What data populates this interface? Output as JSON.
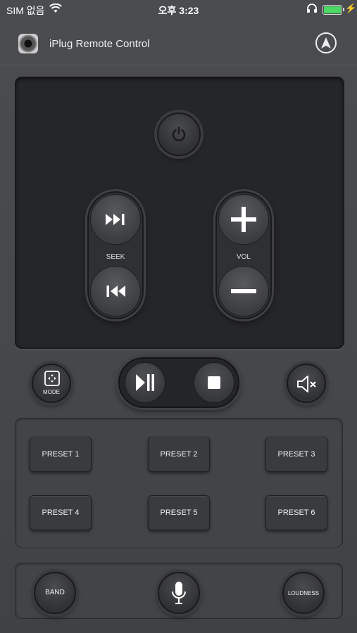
{
  "status_bar": {
    "carrier": "SIM 없음",
    "time": "오후 3:23",
    "battery_color": "#4cd964"
  },
  "header": {
    "title": "iPlug Remote Control",
    "app_icon": "speaker-app-icon",
    "nav_icon": "navigation-arrow-icon"
  },
  "controls": {
    "power_icon": "power-icon",
    "seek_label": "SEEK",
    "vol_label": "VOL",
    "mode_label": "MODE"
  },
  "presets": [
    "PRESET 1",
    "PRESET 2",
    "PRESET 3",
    "PRESET 4",
    "PRESET 5",
    "PRESET 6"
  ],
  "bottom": {
    "band_label": "BAND",
    "loudness_label": "LOUDNESS",
    "mic_icon": "microphone-icon"
  }
}
